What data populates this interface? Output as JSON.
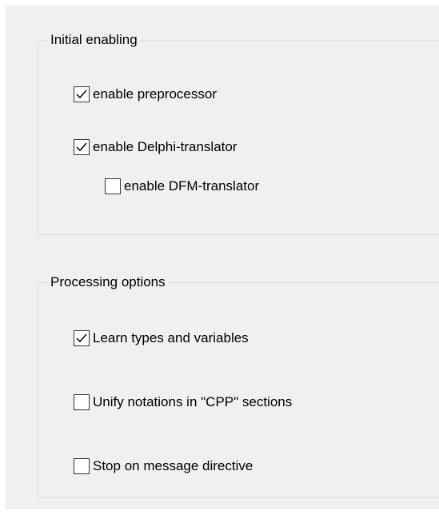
{
  "initial_enabling": {
    "title": "Initial enabling",
    "options": [
      {
        "label": "enable preprocessor",
        "checked": true
      },
      {
        "label": "enable Delphi-translator",
        "checked": true
      },
      {
        "label": "enable DFM-translator",
        "checked": false
      }
    ]
  },
  "processing_options": {
    "title": "Processing options",
    "options": [
      {
        "label": "Learn types and variables",
        "checked": true
      },
      {
        "label": "Unify notations in \"CPP\" sections",
        "checked": false
      },
      {
        "label": "Stop on message directive",
        "checked": false
      }
    ]
  },
  "colors": {
    "panel_background": "#f0f0f0",
    "group_border": "#dcdcdc",
    "checkbox_border": "#333333",
    "checkmark": "#000000"
  },
  "icons": {
    "checked": "checkmark-icon"
  }
}
